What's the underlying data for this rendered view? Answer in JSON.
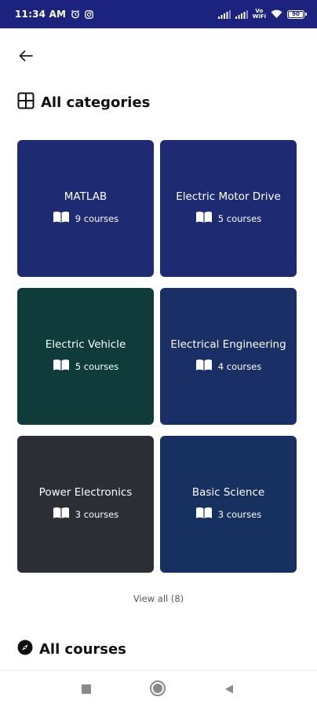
{
  "status_bar": {
    "time": "11:34 AM",
    "vowifi": "Vo\nWiFi",
    "battery": "90",
    "battery_level": 0.9
  },
  "header": {
    "back_icon": "arrow-left-icon"
  },
  "categories_section": {
    "icon": "grid-icon",
    "title": "All categories",
    "view_all": "View all (8)"
  },
  "categories": [
    {
      "title": "MATLAB",
      "count": "9 courses",
      "color": "#1e2a72"
    },
    {
      "title": "Electric Motor Drive",
      "count": "5 courses",
      "color": "#1e2a72"
    },
    {
      "title": "Electric Vehicle",
      "count": "5 courses",
      "color": "#0f3b3b"
    },
    {
      "title": "Electrical Engineering",
      "count": "4 courses",
      "color": "#1a2f66"
    },
    {
      "title": "Power Electronics",
      "count": "3 courses",
      "color": "#2b2e34"
    },
    {
      "title": "Basic Science",
      "count": "3 courses",
      "color": "#16305f"
    }
  ],
  "courses_section": {
    "icon": "compass-icon",
    "title": "All courses"
  },
  "nav": {
    "recents_icon": "square-icon",
    "home_icon": "circle-icon",
    "back_icon": "triangle-back-icon"
  },
  "colors": {
    "status_bar": "#1b237e",
    "card_blue": "#1e2a72",
    "card_teal": "#0f3b3b",
    "card_gray": "#2b2e34"
  }
}
